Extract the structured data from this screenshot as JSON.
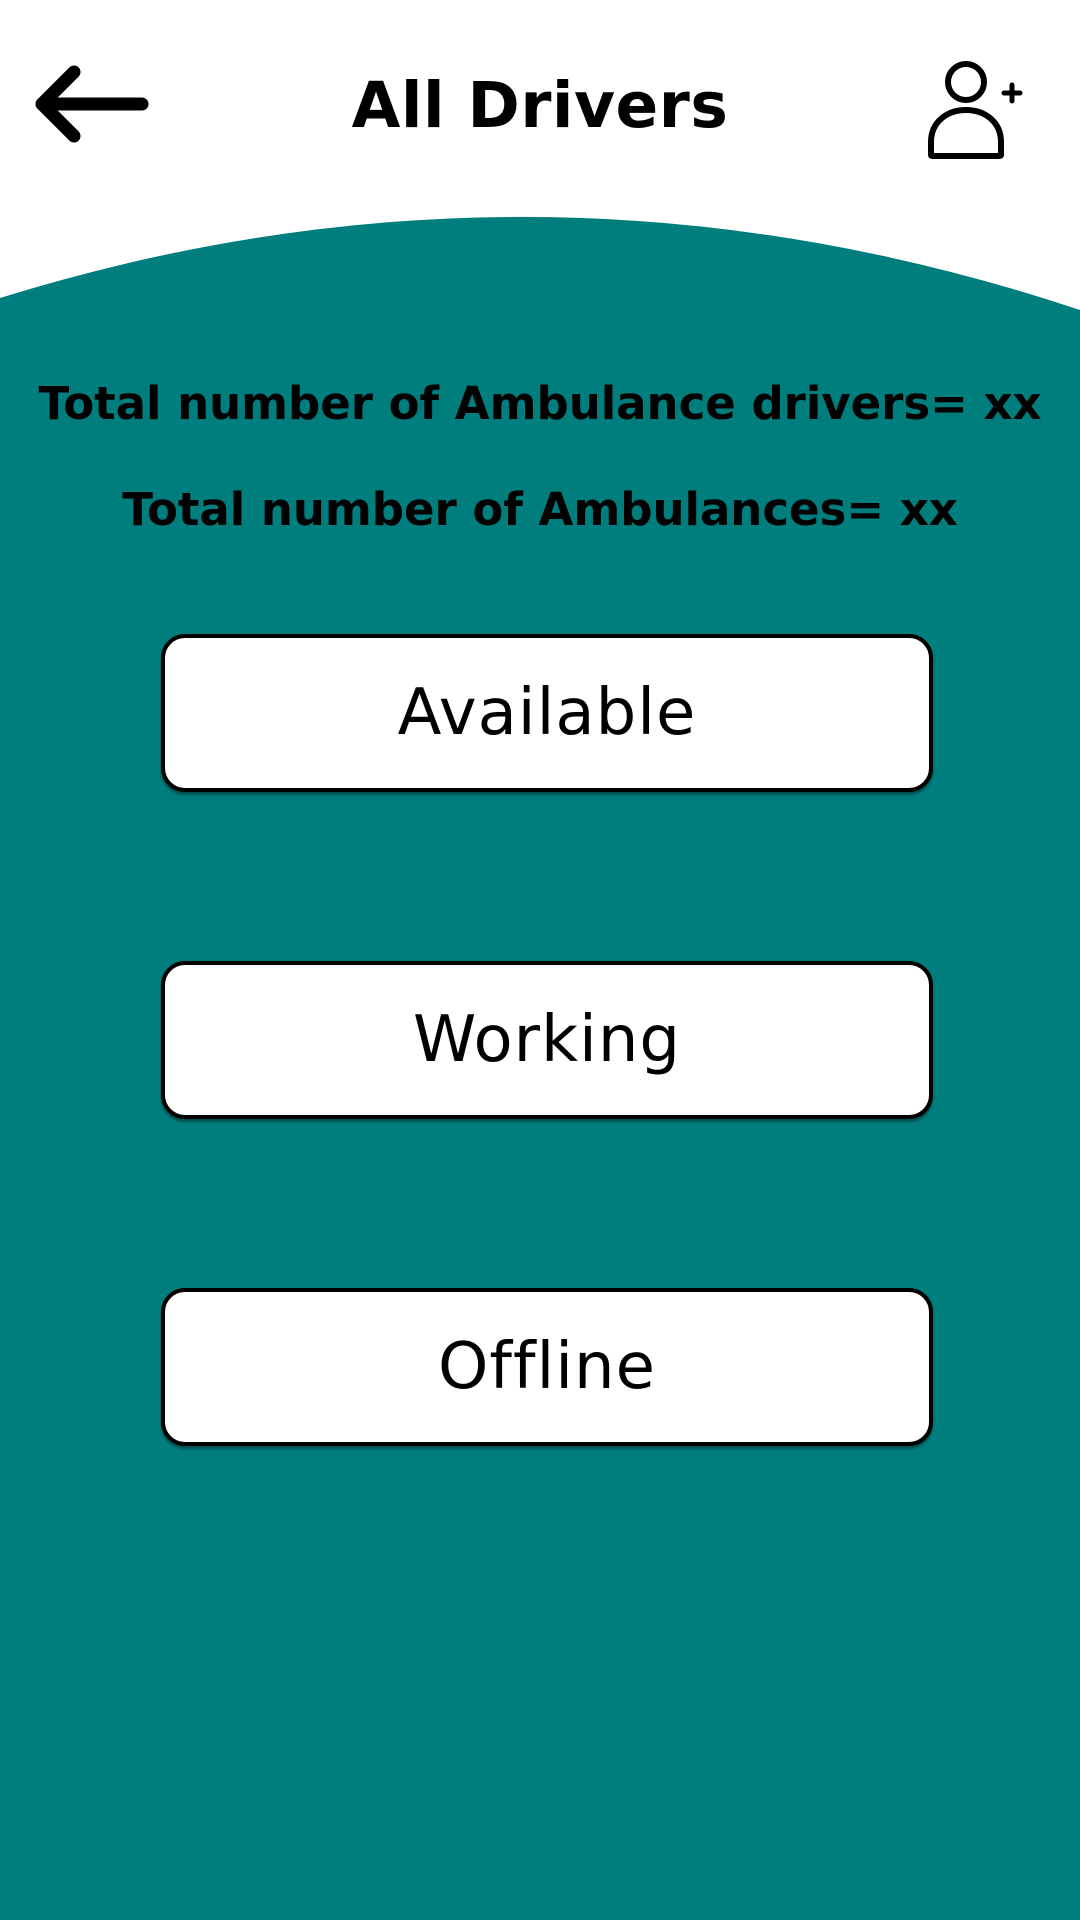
{
  "header": {
    "title": "All Drivers",
    "back_icon": "arrow-left-icon",
    "add_icon": "user-plus-icon"
  },
  "stats": {
    "drivers_text": "Total number of Ambulance drivers= xx",
    "ambulances_text": "Total number of Ambulances= xx"
  },
  "status_buttons": [
    {
      "label": "Available"
    },
    {
      "label": "Working"
    },
    {
      "label": "Offline"
    }
  ],
  "colors": {
    "panel": "#007d7d",
    "background": "#ffffff",
    "button_fill": "#ffffff",
    "text": "#000000"
  }
}
